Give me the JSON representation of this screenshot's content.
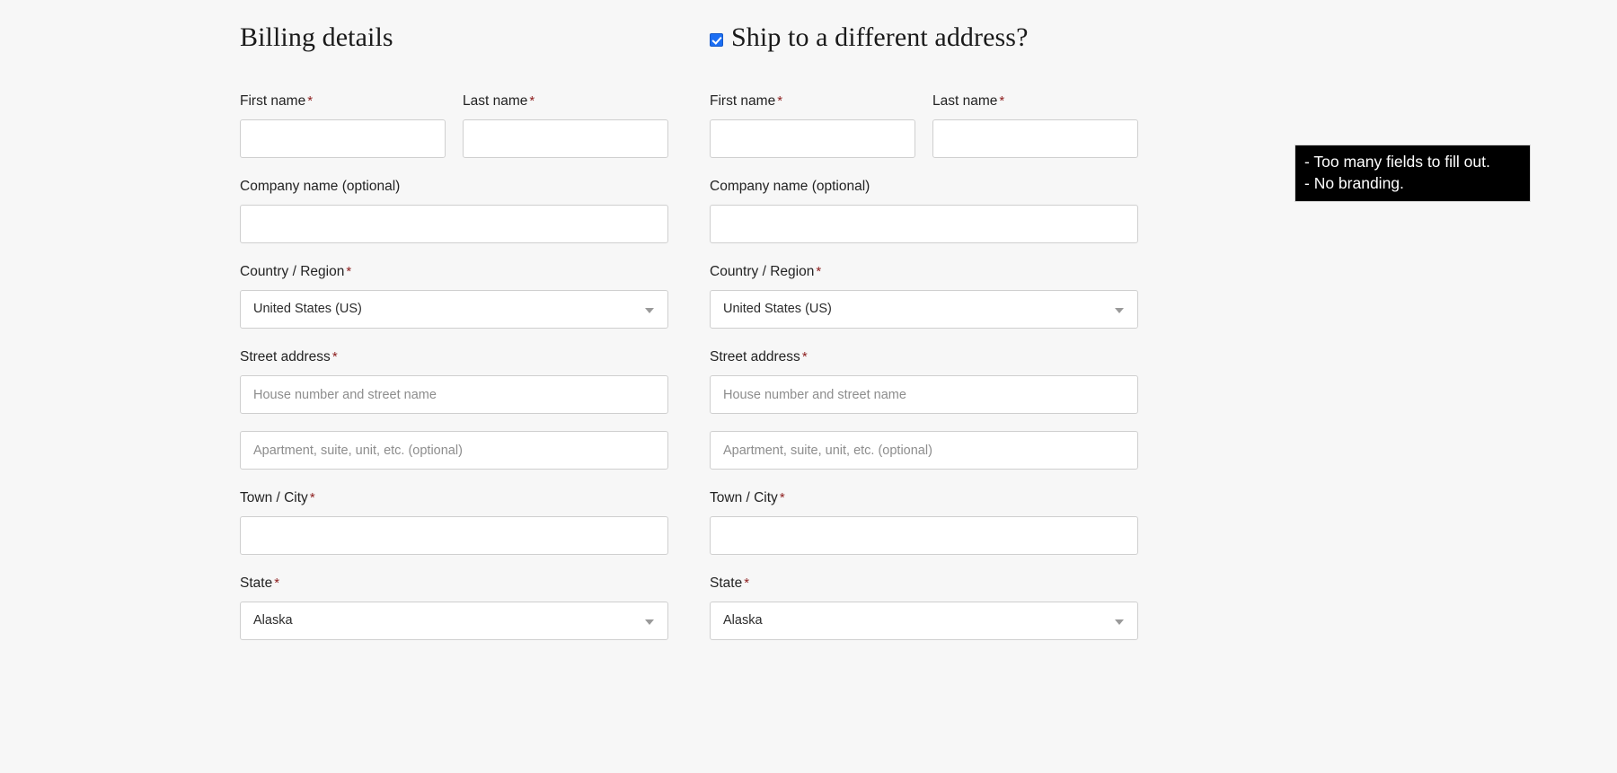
{
  "page": {
    "background_color": "#f7f7f7",
    "accent_checkbox_color": "#1b6ef3",
    "required_marker_color": "#8c1c1c",
    "required_marker": "*"
  },
  "billing": {
    "heading": "Billing details",
    "fields": {
      "first_name_label": "First name",
      "last_name_label": "Last name",
      "company_label": "Company name (optional)",
      "country_label": "Country / Region",
      "country_value": "United States (US)",
      "street_label": "Street address",
      "street_placeholder": "House number and street name",
      "street2_placeholder": "Apartment, suite, unit, etc. (optional)",
      "city_label": "Town / City",
      "state_label": "State",
      "state_value": "Alaska",
      "first_name_value": "",
      "last_name_value": "",
      "company_value": "",
      "street_value": "",
      "street2_value": "",
      "city_value": ""
    }
  },
  "shipping": {
    "heading": "Ship to a different address?",
    "checkbox_checked": true,
    "fields": {
      "first_name_label": "First name",
      "last_name_label": "Last name",
      "company_label": "Company name (optional)",
      "country_label": "Country / Region",
      "country_value": "United States (US)",
      "street_label": "Street address",
      "street_placeholder": "House number and street name",
      "street2_placeholder": "Apartment, suite, unit, etc. (optional)",
      "city_label": "Town / City",
      "state_label": "State",
      "state_value": "Alaska",
      "first_name_value": "",
      "last_name_value": "",
      "company_value": "",
      "street_value": "",
      "street2_value": "",
      "city_value": ""
    }
  },
  "annotation": {
    "line1": "- Too many fields to fill out.",
    "line2": "- No branding."
  }
}
